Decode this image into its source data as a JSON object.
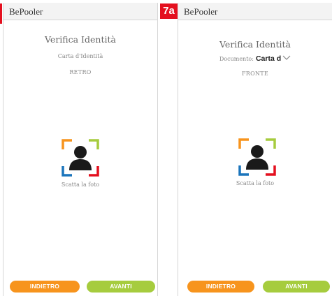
{
  "colors": {
    "badge_red": "#e4101f",
    "back_orange": "#f7941d",
    "forward_green": "#a6cc3e",
    "corner_orange": "#f7941d",
    "corner_green": "#a6cc3e",
    "corner_blue": "#1b75bc",
    "corner_red": "#e4101f"
  },
  "step_badge": "7a",
  "screens": [
    {
      "app_name": "BePooler",
      "title": "Verifica Identità",
      "document_line": "Carta d'Identità",
      "side": "RETRO",
      "camera_icon": "user-silhouette-icon",
      "shoot_label": "Scatta la foto",
      "back_label": "INDIETRO",
      "next_label": "AVANTI"
    },
    {
      "app_name": "BePooler",
      "title": "Verifica Identità",
      "document_label": "Documento:",
      "document_value": "Carta d",
      "side": "FRONTE",
      "camera_icon": "user-silhouette-icon",
      "shoot_label": "Scatta la foto",
      "back_label": "INDIETRO",
      "next_label": "AVANTI"
    }
  ]
}
